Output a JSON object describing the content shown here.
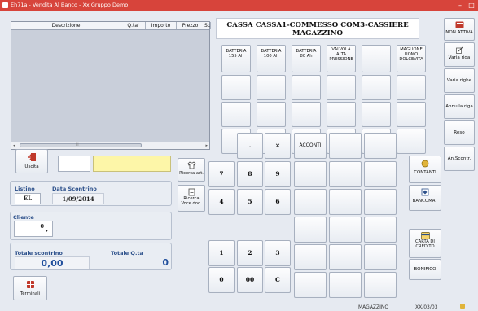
{
  "window": {
    "title": "Eh71a - Vendita Al Banco - Xx Gruppo Demo",
    "minimize": "–",
    "maximize": "□"
  },
  "grid": {
    "columns": [
      "Descrizione",
      "Q.ta'",
      "Importo",
      "Prezzo",
      "Sc"
    ],
    "scroll_left": "◂",
    "scroll_right": "▸",
    "scroll_grip": "III"
  },
  "buttons": {
    "uscita": "Uscita",
    "ricerca_art": "Ricerca art.",
    "ricerca_voce_doc": [
      "Ricerca",
      "Voce doc."
    ],
    "terminali": "Terminali"
  },
  "listino": {
    "label": "Listino",
    "value": "EL"
  },
  "data_scontrino": {
    "label": "Data Scontrino",
    "value": "1/09/2014"
  },
  "cliente": {
    "label": "Cliente",
    "value": "0"
  },
  "totale_scontrino": {
    "label": "Totale scontrino",
    "value": "0,00"
  },
  "totale_qta": {
    "label": "Totale Q.ta",
    "value": "0"
  },
  "cassa_header": {
    "line1": "CASSA CASSA1-COMMESSO COM3-CASSIERE",
    "line2": "MAGAZZINO"
  },
  "products": [
    [
      "BATTERIA",
      "155 Ah"
    ],
    [
      "BATTERIA",
      "100 Ah"
    ],
    [
      "BATTERIA",
      "80 Ah"
    ],
    [
      "VALVOLA",
      "ALTA",
      "PRESSIONE"
    ],
    [],
    [
      "MAGLIONE",
      "UOMO",
      "DOLCEVITA"
    ]
  ],
  "keypad": {
    "row0": [
      "",
      ".",
      "×"
    ],
    "row1": [
      "7",
      "8",
      "9"
    ],
    "row2": [
      "4",
      "5",
      "6"
    ],
    "row3": [
      "1",
      "2",
      "3"
    ],
    "row4": [
      "0",
      "00",
      "C"
    ]
  },
  "acconti": "ACCONTI",
  "payments": {
    "contanti": "CONTANTI",
    "bancomat": "BANCOMAT",
    "carta_di_credito": [
      "CARTA DI",
      "CREDITO"
    ],
    "bonifico": "BONIFICO"
  },
  "side_actions": {
    "non_attiva": "NON ATTIVA",
    "varia_riga": "Varia riga",
    "varia_righe": "Varia righe",
    "annulla_riga": "Annulla riga",
    "reso": "Reso",
    "an_scontr": "An.Scontr."
  },
  "status_bar": {
    "left": "MAGAZZINO",
    "right": "XX/03/03"
  },
  "colors": {
    "titlebar": "#d7443b",
    "yellow_field": "#fdf6a8",
    "label_blue": "#2b4f8a"
  }
}
